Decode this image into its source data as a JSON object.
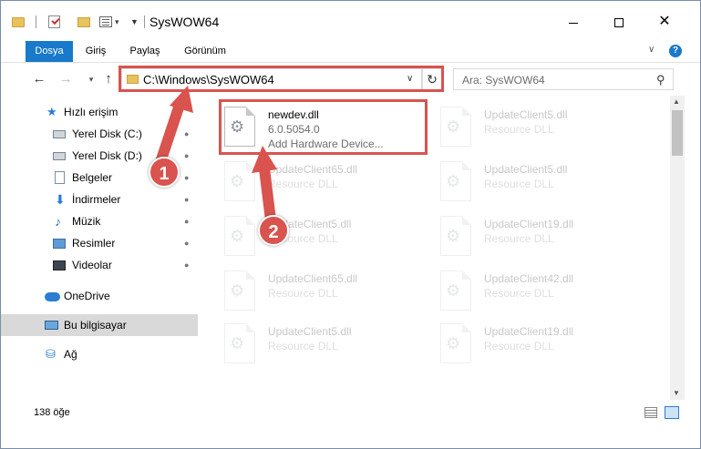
{
  "window": {
    "title": "SysWOW64",
    "min_glyph": "",
    "close_glyph": "✕"
  },
  "ribbon": {
    "tabs": [
      "Dosya",
      "Giriş",
      "Paylaş",
      "Görünüm"
    ],
    "help": "?"
  },
  "nav": {
    "back": "←",
    "forward": "→",
    "recent": "▾",
    "up": "↑",
    "address": "C:\\Windows\\SysWOW64",
    "address_drop": "∨",
    "refresh": "↻",
    "search_placeholder": "Ara: SysWOW64",
    "search_icon": "⚲"
  },
  "sidebar": {
    "items": [
      {
        "label": "Hızlı erişim",
        "icon": "star-icon",
        "pinned": false
      },
      {
        "label": "Yerel Disk (C:)",
        "icon": "disk-icon",
        "pinned": true
      },
      {
        "label": "Yerel Disk (D:)",
        "icon": "disk-icon",
        "pinned": true
      },
      {
        "label": "Belgeler",
        "icon": "document-icon",
        "pinned": true
      },
      {
        "label": "İndirmeler",
        "icon": "download-icon",
        "pinned": true
      },
      {
        "label": "Müzik",
        "icon": "music-icon",
        "pinned": true
      },
      {
        "label": "Resimler",
        "icon": "pictures-icon",
        "pinned": true
      },
      {
        "label": "Videolar",
        "icon": "videos-icon",
        "pinned": true
      },
      {
        "label": "OneDrive",
        "icon": "cloud-icon",
        "pinned": false
      },
      {
        "label": "Bu bilgisayar",
        "icon": "computer-icon",
        "pinned": false,
        "selected": true
      },
      {
        "label": "Ağ",
        "icon": "network-icon",
        "pinned": false
      }
    ],
    "pin_glyph": "📌"
  },
  "files": [
    {
      "name": "newdev.dll",
      "line2": "6.0.5054.0",
      "line3": "Add Hardware Device...",
      "faded": false
    },
    {
      "name": "UpdateClient5.dll",
      "line2": "Resource DLL",
      "line3": "",
      "faded": true
    },
    {
      "name": "UpdateClient65.dll",
      "line2": "Resource DLL",
      "line3": "",
      "faded": true
    },
    {
      "name": "UpdateClient5.dll",
      "line2": "Resource DLL",
      "line3": "",
      "faded": true
    },
    {
      "name": "UpdateClient5.dll",
      "line2": "Resource DLL",
      "line3": "",
      "faded": true
    },
    {
      "name": "UpdateClient19.dll",
      "line2": "Resource DLL",
      "line3": "",
      "faded": true
    },
    {
      "name": "UpdateClient65.dll",
      "line2": "Resource DLL",
      "line3": "",
      "faded": true
    },
    {
      "name": "UpdateClient42.dll",
      "line2": "Resource DLL",
      "line3": "",
      "faded": true
    },
    {
      "name": "UpdateClient5.dll",
      "line2": "Resource DLL",
      "line3": "",
      "faded": true
    },
    {
      "name": "UpdateClient19.dll",
      "line2": "Resource DLL",
      "line3": "",
      "faded": true
    }
  ],
  "status": {
    "count": "138 öğe"
  },
  "markers": [
    "1",
    "2"
  ],
  "colors": {
    "accent": "#1979ca",
    "highlight": "#d9534f"
  }
}
